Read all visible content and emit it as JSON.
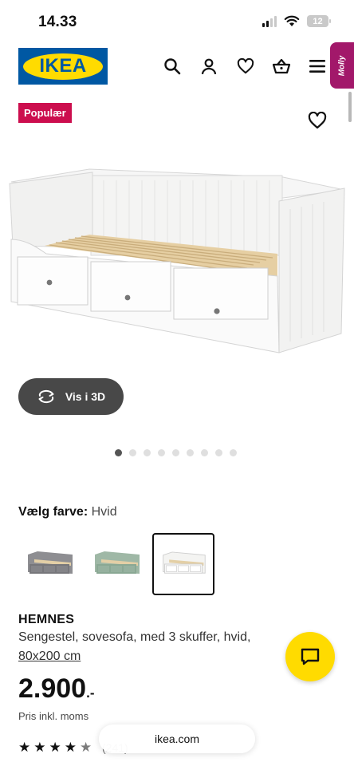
{
  "status_bar": {
    "time": "14.33",
    "battery": "12"
  },
  "header": {
    "logo_text": "IKEA",
    "molly_label": "Molly"
  },
  "badge": "Populær",
  "hero": {
    "view_3d_label": "Vis i 3D",
    "slide_count": 9,
    "active_slide": 1
  },
  "color": {
    "label": "Vælg farve:",
    "value": "Hvid",
    "swatches": [
      {
        "name": "grey",
        "color": "#8e8e92"
      },
      {
        "name": "green",
        "color": "#9fb8a6"
      },
      {
        "name": "white",
        "color": "#f4f4f2"
      }
    ],
    "selected_index": 2
  },
  "product": {
    "name": "HEMNES",
    "description": "Sengestel, sovesofa, med 3 skuffer, hvid,",
    "size": "80x200 cm",
    "price": "2.900",
    "price_suffix": ".-",
    "price_note": "Pris inkl. moms",
    "rating": 4.5,
    "reviews": "(241)"
  },
  "browser": {
    "url": "ikea.com"
  },
  "colors": {
    "brand_blue": "#0058a3",
    "brand_yellow": "#ffdb00",
    "badge_red": "#cc0e4e",
    "molly_purple": "#a2186a"
  }
}
